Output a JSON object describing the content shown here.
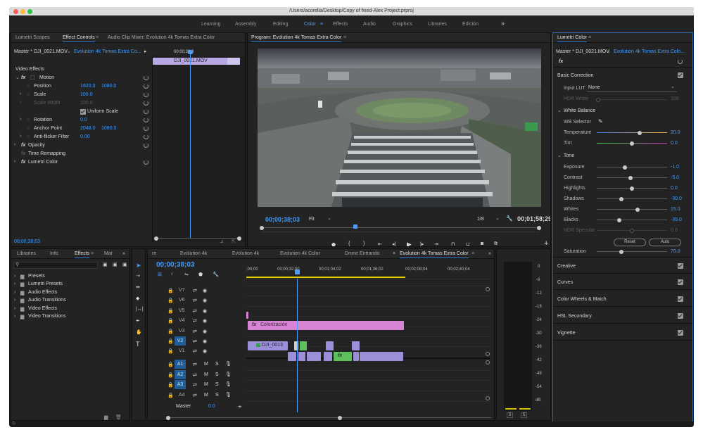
{
  "window": {
    "title": "/Users/acorella/Desktop/Copy of fixed-Alex Project.prproj"
  },
  "workspaces": [
    {
      "label": "Learning"
    },
    {
      "label": "Assembly"
    },
    {
      "label": "Editing"
    },
    {
      "label": "Color"
    },
    {
      "label": "Effects"
    },
    {
      "label": "Audio"
    },
    {
      "label": "Graphics"
    },
    {
      "label": "Libraries"
    },
    {
      "label": "Edición"
    }
  ],
  "workspace_overflow": "»",
  "effect_controls": {
    "tabs": {
      "scopes": "Lumetri Scopes",
      "effect_controls": "Effect Controls",
      "audio_mixer": "Audio Clip Mixer: Evolution  4k  Tomas Extra Color"
    },
    "master": "Master * DJI_0021.MOV",
    "sequence": "Evolution  4k  Tomas Extra Co...",
    "ruler_time": "00;00;38;0",
    "clip_label": "DJI_0021.MOV",
    "section": "Video Effects",
    "rows": {
      "motion": "Motion",
      "position": "Position",
      "position_x": "1920.0",
      "position_y": "1080.0",
      "scale": "Scale",
      "scale_val": "100.0",
      "scale_width": "Scale Width",
      "scale_width_val": "100.0",
      "uniform_scale": "Uniform Scale",
      "rotation": "Rotation",
      "rotation_val": "0.0",
      "anchor": "Anchor Point",
      "anchor_x": "2048.0",
      "anchor_y": "1080.0",
      "antiflicker": "Anti-flicker Filter",
      "antiflicker_val": "0.00",
      "opacity": "Opacity",
      "time_remap": "Time Remapping",
      "lumetri": "Lumetri Color"
    },
    "timecode": "00;00;38;03"
  },
  "program": {
    "title": "Program: Evolution  4k  Tomas Extra Color",
    "timecode": "00;00;38;03",
    "fit": "Fit",
    "ratio": "1/8",
    "duration": "00;01;58;29",
    "add_button": "+"
  },
  "lumetri": {
    "title": "Lumetri Color",
    "master": "Master * DJI_0021.MOV",
    "sequence": "Evolution  4k  Tomas Extra Colo...",
    "fx": "fx",
    "basic_correction": "Basic Correction",
    "input_lut_label": "Input LUT",
    "input_lut_value": "None",
    "hdr_white_label": "HDR White",
    "hdr_white_value": "100",
    "white_balance": "White Balance",
    "wb_selector": "WB Selector",
    "temperature_label": "Temperature",
    "temperature_value": "20.0",
    "tint_label": "Tint",
    "tint_value": "0.0",
    "tone": "Tone",
    "exposure_label": "Exposure",
    "exposure_value": "-1.0",
    "contrast_label": "Contrast",
    "contrast_value": "-5.0",
    "highlights_label": "Highlights",
    "highlights_value": "0.0",
    "shadows_label": "Shadows",
    "shadows_value": "-30.0",
    "whites_label": "Whites",
    "whites_value": "15.0",
    "blacks_label": "Blacks",
    "blacks_value": "-35.0",
    "hdr_specular_label": "HDR Specular",
    "hdr_specular_value": "0.0",
    "reset": "Reset",
    "auto": "Auto",
    "saturation_label": "Saturation",
    "saturation_value": "70.0",
    "sections": [
      "Creative",
      "Curves",
      "Color Wheels & Match",
      "HSL Secondary",
      "Vignette"
    ]
  },
  "effects_panel": {
    "tabs": {
      "libraries": "Libraries",
      "info": "Info",
      "effects": "Effects",
      "markers": "Mar"
    },
    "tree": [
      "Presets",
      "Lumetri Presets",
      "Audio Effects",
      "Audio Transitions",
      "Video Effects",
      "Video Transitions"
    ]
  },
  "timeline": {
    "tabs": [
      "re",
      "Evolution 4k",
      "Evolution 4k",
      "Evolution 4k  Color",
      "Drone Entrando",
      "Evolution  4k  Tomas Extra Color"
    ],
    "tab_close": "×",
    "timecode": "00;00;38;03",
    "ruler": [
      ";00;00",
      "00;00;32;00",
      "00;01;04;02",
      "00;01;36;02",
      "00;02;08;04",
      "00;02;40;04"
    ],
    "video_tracks": [
      "V7",
      "V6",
      "V5",
      "V4",
      "V3",
      "V2",
      "V1"
    ],
    "audio_tracks": [
      "A1",
      "A2",
      "A3",
      "A4"
    ],
    "master_label": "Master",
    "master_value": "0.0",
    "clip_colorizacion": "Colorización",
    "clip_dji": "DJI_0013",
    "fx": "fx"
  },
  "meter": {
    "scale": [
      "0",
      "-6",
      "-12",
      "-18",
      "-24",
      "-30",
      "-36",
      "-42",
      "-48",
      "-54",
      "dB"
    ],
    "solo": [
      "S",
      "S"
    ]
  }
}
